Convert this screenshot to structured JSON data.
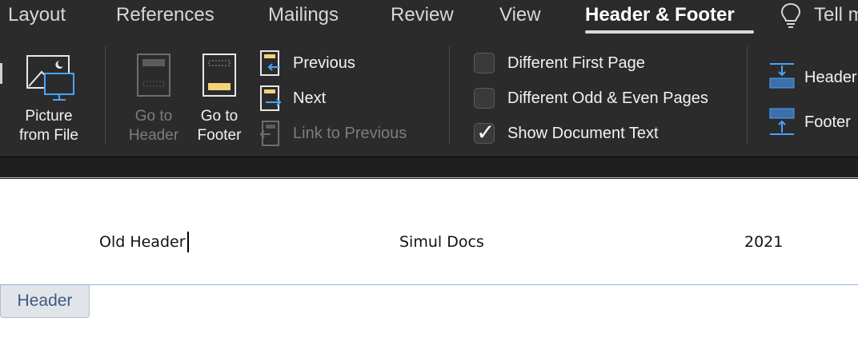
{
  "ribbon": {
    "tabs": [
      {
        "label": "Layout"
      },
      {
        "label": "References"
      },
      {
        "label": "Mailings"
      },
      {
        "label": "Review"
      },
      {
        "label": "View"
      },
      {
        "label": "Header & Footer",
        "active": true
      }
    ],
    "tell_me": "Tell m",
    "insert": {
      "picture_from_file": {
        "line1": "Picture",
        "line2": "from File"
      }
    },
    "navigation": {
      "go_to_header": {
        "line1": "Go to",
        "line2": "Header",
        "enabled": false
      },
      "go_to_footer": {
        "line1": "Go to",
        "line2": "Footer",
        "enabled": true
      },
      "previous": {
        "label": "Previous",
        "enabled": true
      },
      "next": {
        "label": "Next",
        "enabled": true
      },
      "link_to_previous": {
        "label": "Link to Previous",
        "enabled": false
      }
    },
    "options": [
      {
        "label": "Different First Page",
        "checked": false
      },
      {
        "label": "Different Odd & Even Pages",
        "checked": false
      },
      {
        "label": "Show Document Text",
        "checked": true
      }
    ],
    "position": {
      "header_label": "Header",
      "footer_label": "Footer"
    },
    "colors": {
      "background": "#2b2b2b",
      "accent_blue": "#4aa3ff",
      "accent_yellow": "#f3d27a"
    }
  },
  "document": {
    "header": {
      "left": "Old Header",
      "center": "Simul Docs",
      "right": "2021"
    },
    "header_tag": "Header"
  }
}
